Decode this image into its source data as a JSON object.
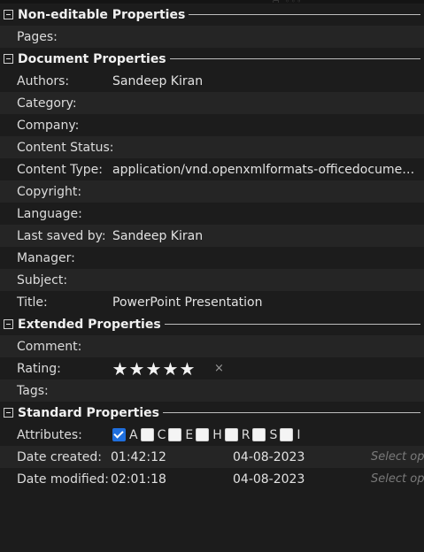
{
  "sections": {
    "non_editable": {
      "title": "Non-editable Properties",
      "rows": [
        {
          "label": "Pages:",
          "value": ""
        }
      ]
    },
    "document": {
      "title": "Document Properties",
      "rows": [
        {
          "label": "Authors:",
          "value": "Sandeep Kiran"
        },
        {
          "label": "Category:",
          "value": ""
        },
        {
          "label": "Company:",
          "value": ""
        },
        {
          "label": "Content Status:",
          "value": ""
        },
        {
          "label": "Content Type:",
          "value": "application/vnd.openxmlformats-officedocument.presentationml.presentation"
        },
        {
          "label": "Copyright:",
          "value": ""
        },
        {
          "label": "Language:",
          "value": ""
        },
        {
          "label": "Last saved by:",
          "value": "Sandeep Kiran"
        },
        {
          "label": "Manager:",
          "value": ""
        },
        {
          "label": "Subject:",
          "value": ""
        },
        {
          "label": "Title:",
          "value": "PowerPoint Presentation"
        }
      ]
    },
    "extended": {
      "title": "Extended Properties",
      "comment_label": "Comment:",
      "comment_value": "",
      "rating_label": "Rating:",
      "rating_value": 5,
      "rating_max": 5,
      "star_glyph": "★",
      "clear_glyph": "×",
      "tags_label": "Tags:",
      "tags_value": ""
    },
    "standard": {
      "title": "Standard Properties",
      "attributes_label": "Attributes:",
      "attributes": [
        {
          "letter": "A",
          "checked": true
        },
        {
          "letter": "C",
          "checked": false
        },
        {
          "letter": "E",
          "checked": false
        },
        {
          "letter": "H",
          "checked": false
        },
        {
          "letter": "R",
          "checked": false
        },
        {
          "letter": "S",
          "checked": false
        },
        {
          "letter": "I",
          "checked": false
        }
      ],
      "date_created": {
        "label": "Date created:",
        "time": "01:42:12",
        "date": "04-08-2023",
        "action": "Select operation"
      },
      "date_modified": {
        "label": "Date modified:",
        "time": "02:01:18",
        "date": "04-08-2023",
        "action": "Select operation"
      }
    }
  },
  "colors": {
    "background": "#1c1c1c",
    "row_alt": "#252525",
    "checkbox_checked": "#1f6fde"
  },
  "icons": {
    "toggle": "collapse-minus-icon",
    "star": "star-icon",
    "clear": "close-icon",
    "check": "checkmark-icon"
  }
}
